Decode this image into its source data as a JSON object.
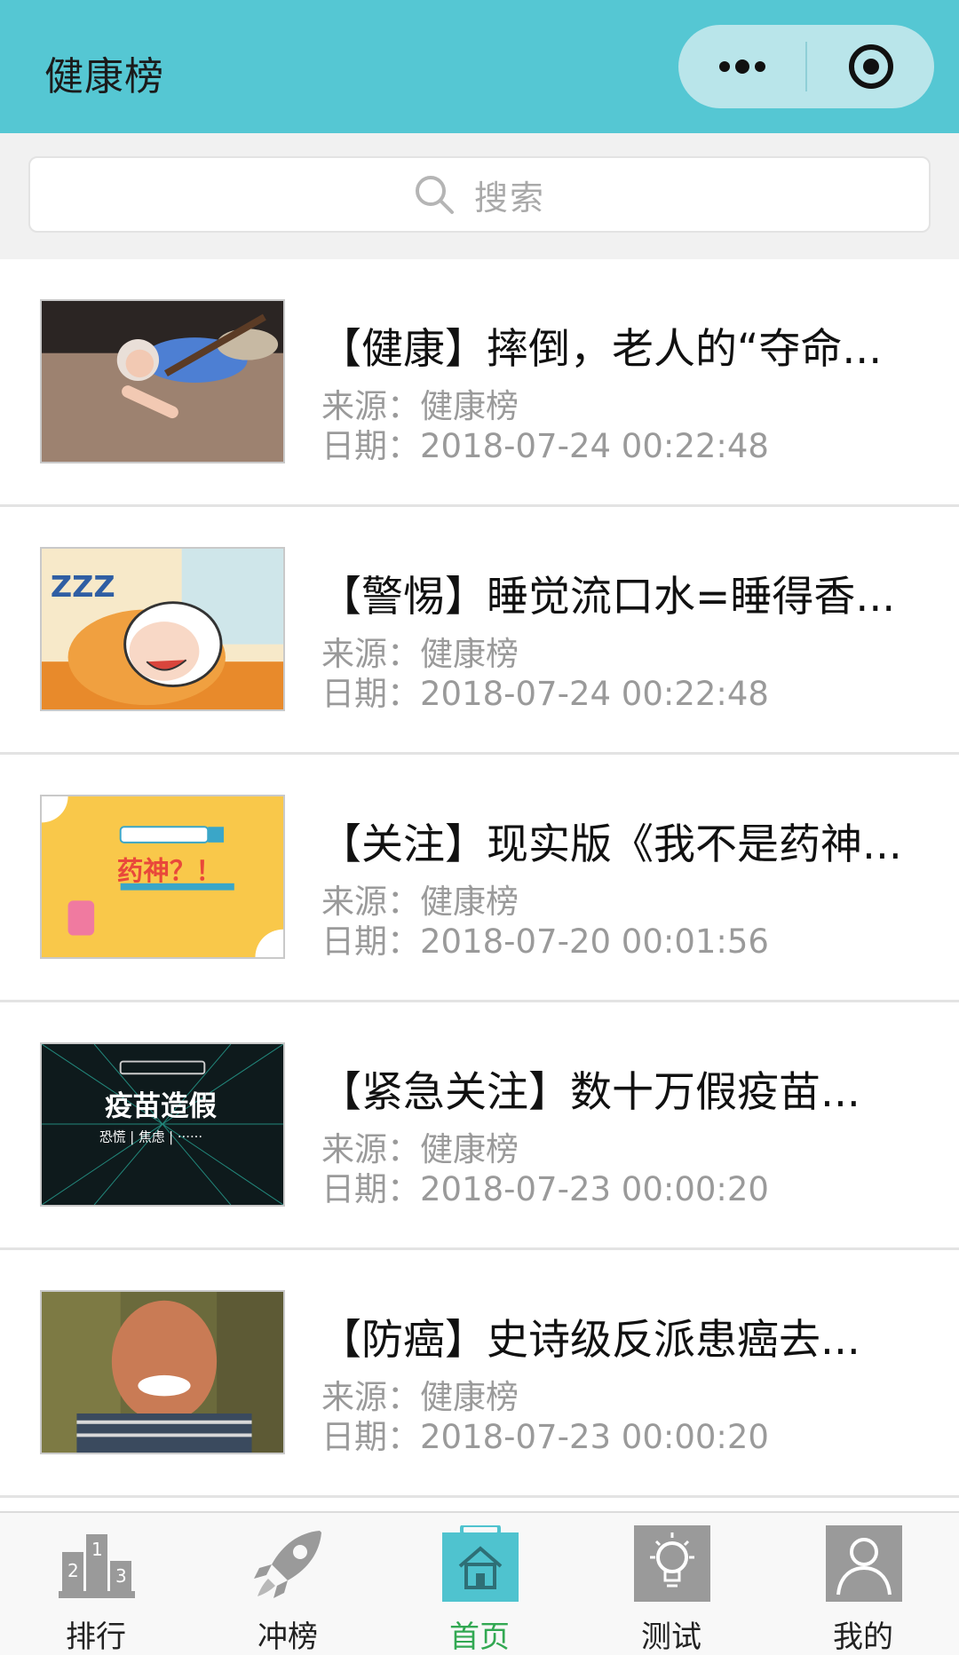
{
  "header": {
    "title": "健康榜"
  },
  "search": {
    "placeholder": "搜索"
  },
  "articles": [
    {
      "title": "【健康】摔倒，老人的“夺命...",
      "source": "来源：健康榜",
      "date": "日期：2018-07-24 00:22:48"
    },
    {
      "title": "【警惕】睡觉流口水=睡得香...",
      "source": "来源：健康榜",
      "date": "日期：2018-07-24 00:22:48"
    },
    {
      "title": "【关注】现实版《我不是药神...",
      "source": "来源：健康榜",
      "date": "日期：2018-07-20 00:01:56",
      "thumb_text": "药神？！"
    },
    {
      "title": "【紧急关注】数十万假疫苗...",
      "source": "来源：健康榜",
      "date": "日期：2018-07-23 00:00:20",
      "thumb_text": "疫苗造假",
      "thumb_subtext": "恐慌 | 焦虑 | ······"
    },
    {
      "title": "【防癌】史诗级反派患癌去...",
      "source": "来源：健康榜",
      "date": "日期：2018-07-23 00:00:20"
    }
  ],
  "tabbar": {
    "items": [
      {
        "label": "排行",
        "icon": "podium-icon"
      },
      {
        "label": "冲榜",
        "icon": "rocket-icon"
      },
      {
        "label": "首页",
        "icon": "home-icon",
        "active": true
      },
      {
        "label": "测试",
        "icon": "lightbulb-icon"
      },
      {
        "label": "我的",
        "icon": "user-icon"
      }
    ]
  },
  "colors": {
    "header_bg": "#55c7d3",
    "active_tab": "#32a852",
    "meta_text": "#9a9a9a"
  }
}
